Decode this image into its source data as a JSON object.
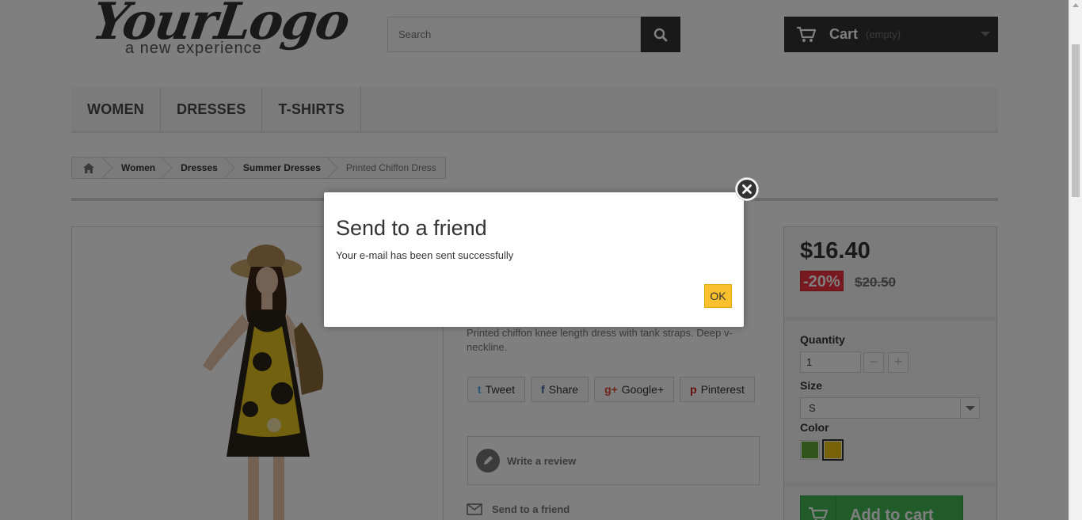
{
  "header": {
    "logo_script": "YourLogo",
    "logo_tagline": "a new experience",
    "search": {
      "placeholder": "Search"
    },
    "cart": {
      "label": "Cart",
      "status": "(empty)"
    }
  },
  "menu": {
    "items": [
      {
        "label": "WOMEN"
      },
      {
        "label": "DRESSES"
      },
      {
        "label": "T-SHIRTS"
      }
    ]
  },
  "breadcrumb": {
    "items": [
      {
        "label": "Women"
      },
      {
        "label": "Dresses"
      },
      {
        "label": "Summer Dresses"
      },
      {
        "label": "Printed Chiffon Dress"
      }
    ]
  },
  "product": {
    "description": "Printed chiffon knee length dress with tank straps. Deep v-neckline.",
    "share": {
      "tweet": "Tweet",
      "share": "Share",
      "google": "Google+",
      "pinterest": "Pinterest"
    },
    "write_review": "Write a review",
    "send_to_friend": "Send to a friend"
  },
  "buy_box": {
    "price": "$16.40",
    "discount": "-20%",
    "old_price": "$20.50",
    "quantity_label": "Quantity",
    "quantity_value": "1",
    "quantity_minus": "−",
    "quantity_plus": "+",
    "size_label": "Size",
    "size_value": "S",
    "color_label": "Color",
    "colors": [
      {
        "name": "green",
        "hex": "#5eaa36"
      },
      {
        "name": "yellow",
        "hex": "#f1c40f",
        "selected": true
      }
    ],
    "add_to_cart": "Add to cart"
  },
  "modal": {
    "title": "Send to a friend",
    "message": "Your e-mail has been sent successfully",
    "ok_label": "OK"
  },
  "colors": {
    "accent_dark": "#333333",
    "discount_red": "#f13340",
    "ok_yellow": "#fbc02d",
    "add_cart_green": "#43b754"
  }
}
